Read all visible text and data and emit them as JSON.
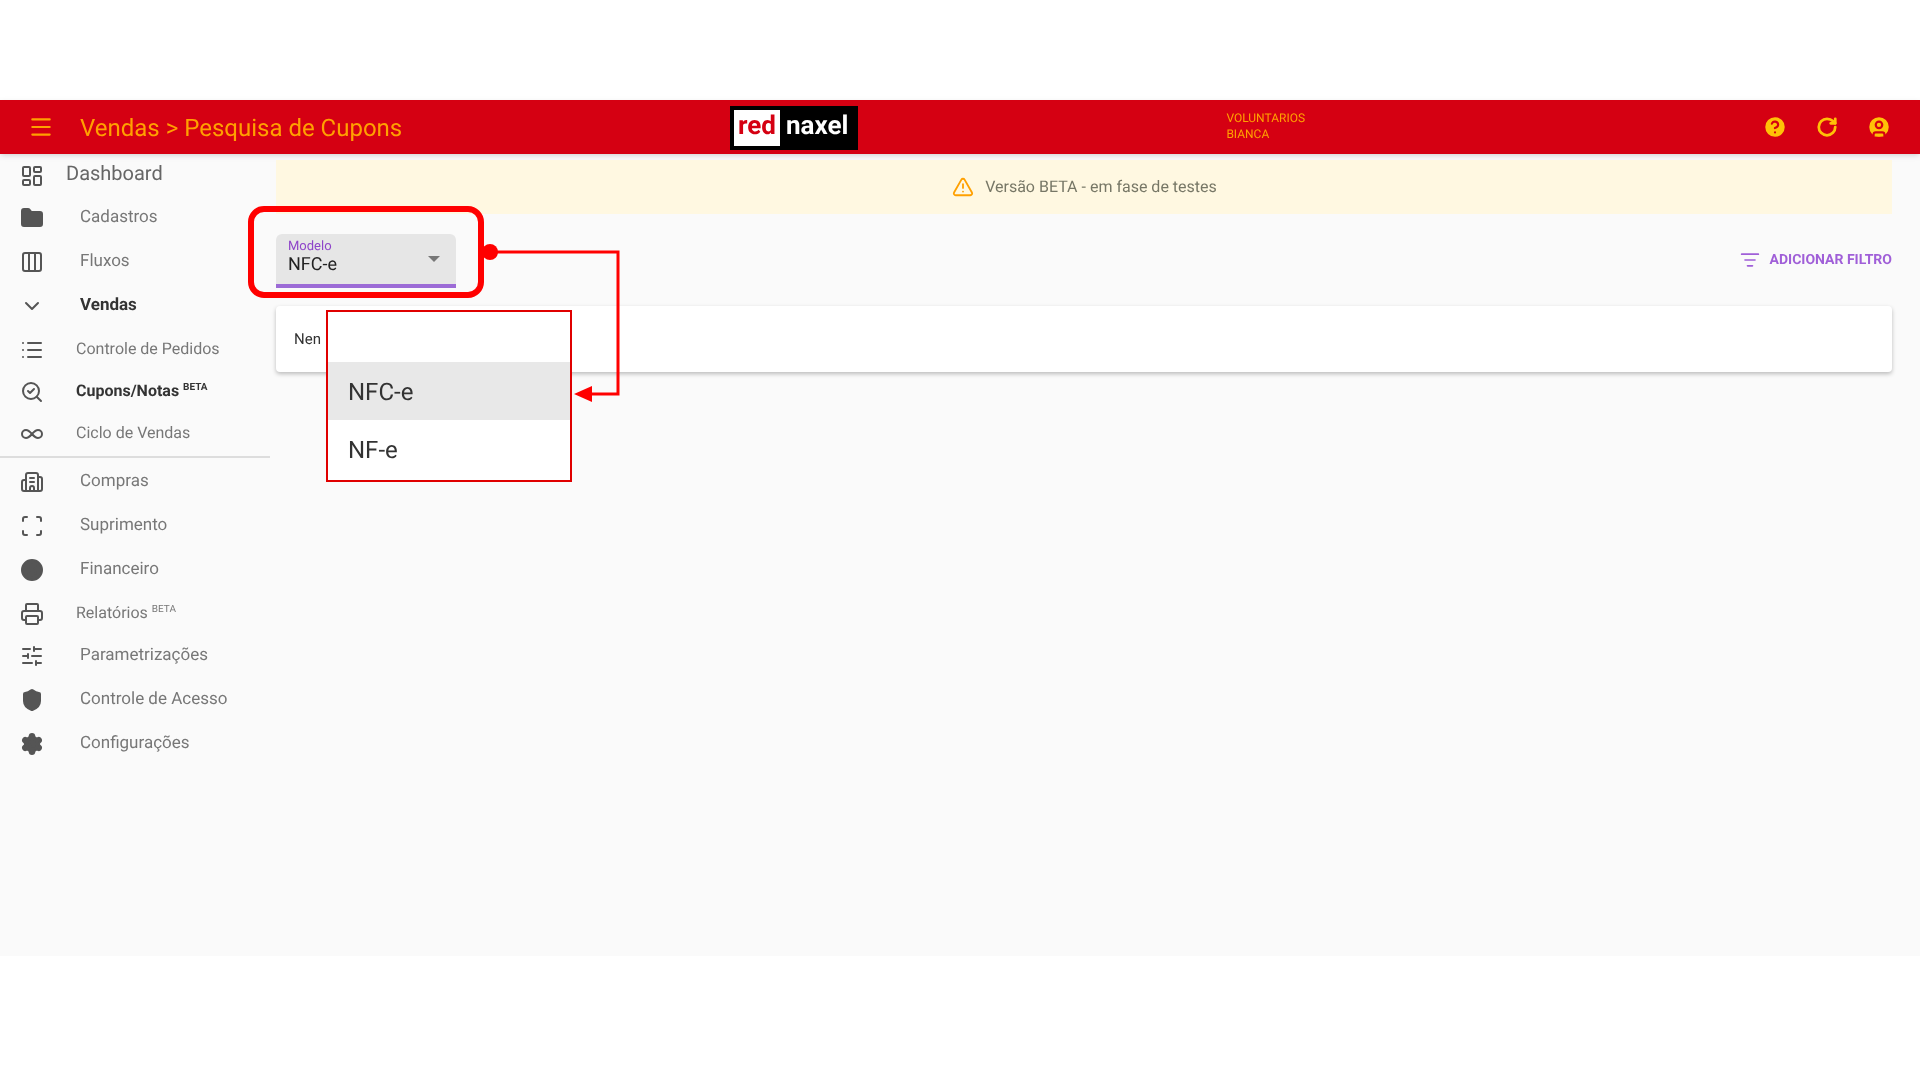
{
  "header": {
    "title": "Vendas > Pesquisa de Cupons",
    "logo": [
      "red",
      "naxel"
    ],
    "user": [
      "VOLUNTARIOS",
      "BIANCA"
    ]
  },
  "sidebar": {
    "items": [
      {
        "label": "Dashboard",
        "kind": "top",
        "selected": false
      },
      {
        "label": "Cadastros",
        "kind": "section",
        "selected": false
      },
      {
        "label": "Fluxos",
        "kind": "section",
        "selected": false
      },
      {
        "label": "Vendas",
        "kind": "expanded",
        "selected": true
      },
      {
        "label": "Controle de Pedidos",
        "kind": "sub",
        "selected": false
      },
      {
        "label": "Cupons/Notas $^{BETA}$",
        "kind": "sub",
        "selected": true
      },
      {
        "label": "Ciclo de Vendas",
        "kind": "sub",
        "selected": false
      },
      {
        "label": "Compras",
        "kind": "section",
        "selected": false
      },
      {
        "label": "Suprimento",
        "kind": "section",
        "selected": false
      },
      {
        "label": "Financeiro",
        "kind": "section",
        "selected": false
      },
      {
        "label": "Relatórios $^{BETA}$",
        "kind": "sub",
        "selected": false
      },
      {
        "label": "Parametrizações",
        "kind": "section",
        "selected": false
      },
      {
        "label": "Controle de Acesso",
        "kind": "section",
        "selected": false
      },
      {
        "label": "Configurações",
        "kind": "section",
        "selected": false
      }
    ]
  },
  "banner": "Versão BETA - em fase de testes",
  "filter": {
    "label": "Modelo",
    "value": "NFC-e"
  },
  "add_filter": "ADICIONAR FILTRO",
  "results": "Nen",
  "dropdown": {
    "options": [
      {
        "label": "NFC-e",
        "selected": true
      },
      {
        "label": "NF-e",
        "selected": false
      }
    ]
  }
}
